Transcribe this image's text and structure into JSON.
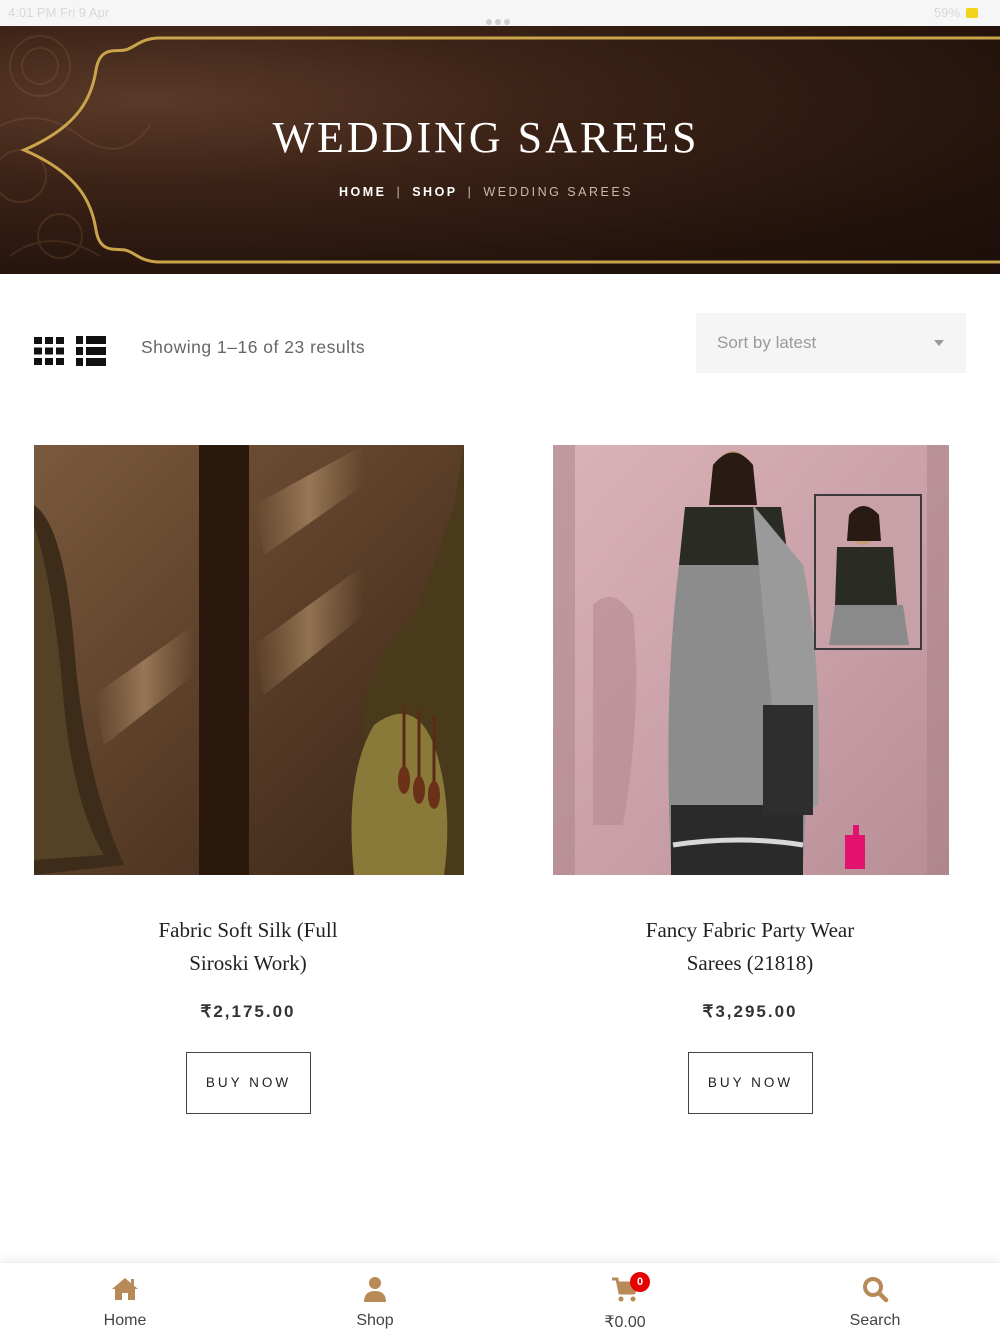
{
  "status_bar": {
    "left_text": "4:01 PM   Fri 9 Apr",
    "right_text": "59%",
    "battery_color": "#f2d21a"
  },
  "hero": {
    "title": "WEDDING SAREES",
    "breadcrumb": {
      "home": "HOME",
      "shop": "SHOP",
      "current": "WEDDING SAREES"
    },
    "gold_color": "#c9a44a"
  },
  "toolbar": {
    "result_count": "Showing 1–16 of 23 results",
    "sort_selected": "Sort by latest",
    "grid_icon": "grid-view-icon",
    "list_icon": "list-view-icon"
  },
  "products": [
    {
      "title_line1": "Fabric Soft Silk (Full",
      "title_line2": "Siroski Work)",
      "price": "₹2,175.00",
      "button": "BUY NOW"
    },
    {
      "title_line1": "Fancy Fabric Party Wear",
      "title_line2": "Sarees (21818)",
      "price": "₹3,295.00",
      "button": "BUY NOW"
    }
  ],
  "bottom_nav": {
    "accent_color": "#b88a58",
    "items": [
      {
        "label": "Home",
        "icon": "home-icon"
      },
      {
        "label": "Shop",
        "icon": "user-icon"
      },
      {
        "label": "₹0.00",
        "icon": "cart-icon",
        "badge": "0"
      },
      {
        "label": "Search",
        "icon": "search-icon"
      }
    ]
  }
}
